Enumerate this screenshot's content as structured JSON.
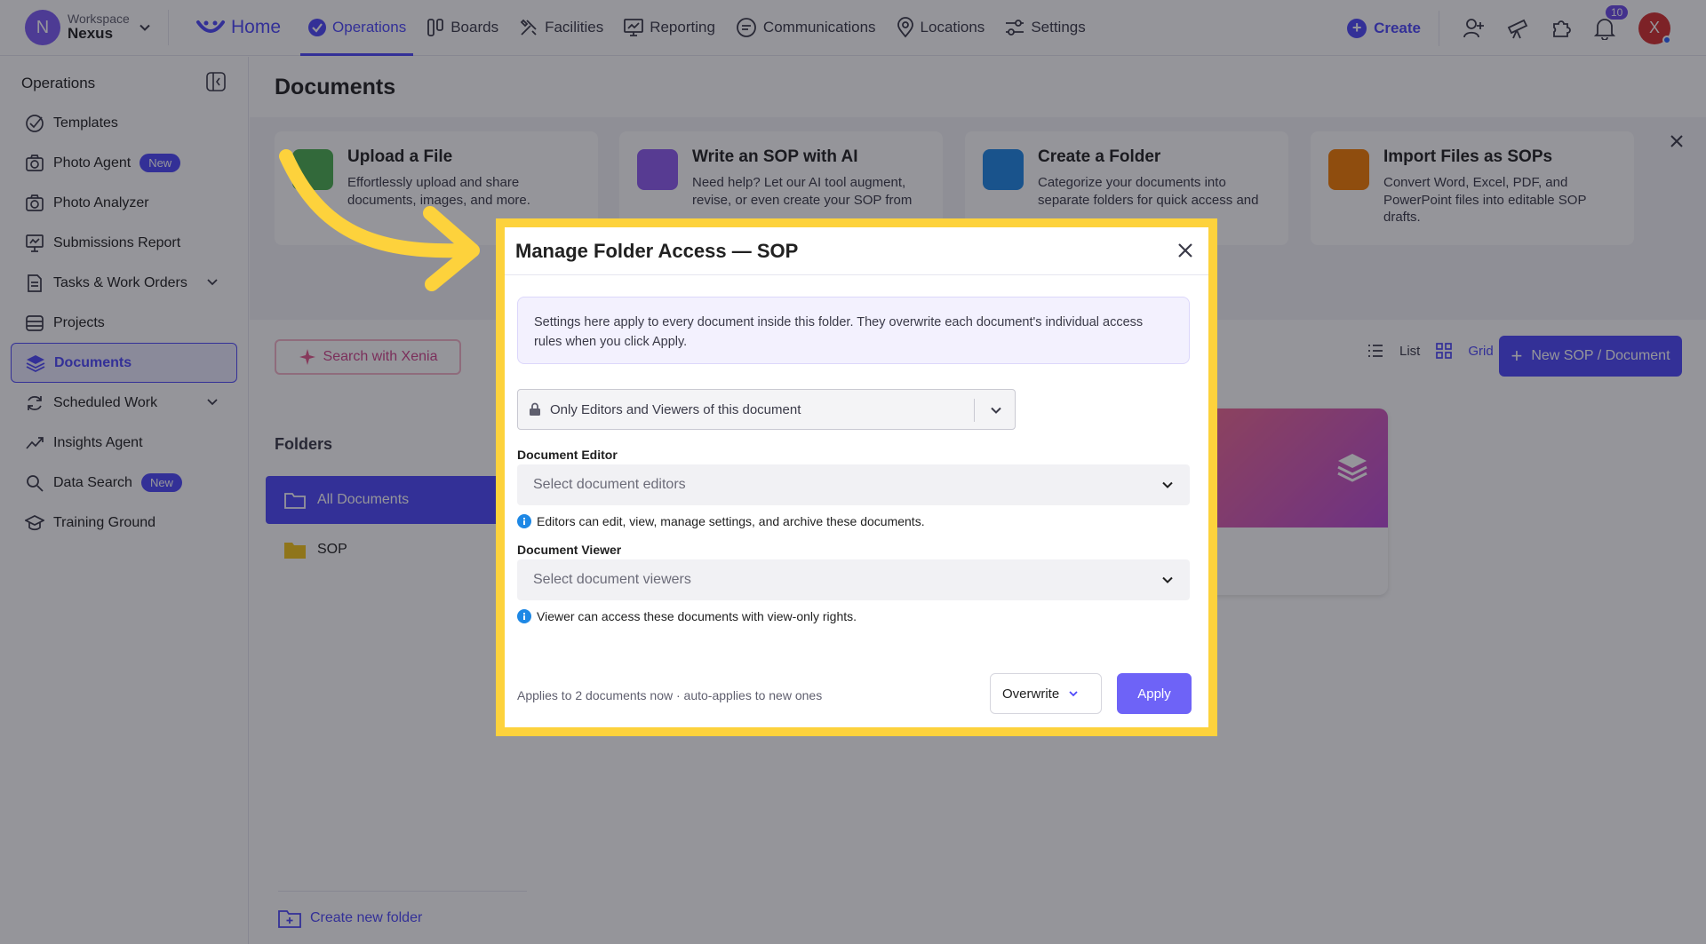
{
  "colors": {
    "accent": "#4e48fa",
    "highlight": "#fdd23c",
    "danger": "#d32f2f",
    "apply": "#6e63f7"
  },
  "topnav": {
    "workspace_label": "Workspace",
    "workspace_name": "Nexus",
    "workspace_initial": "N",
    "items": [
      {
        "label": "Home",
        "icon": "home-icon"
      },
      {
        "label": "Operations",
        "icon": "check-circle-icon"
      },
      {
        "label": "Boards",
        "icon": "boards-icon"
      },
      {
        "label": "Facilities",
        "icon": "tools-icon"
      },
      {
        "label": "Reporting",
        "icon": "chart-icon"
      },
      {
        "label": "Communications",
        "icon": "chat-icon"
      },
      {
        "label": "Locations",
        "icon": "pin-icon"
      },
      {
        "label": "Settings",
        "icon": "sliders-icon"
      }
    ],
    "create_label": "Create",
    "notification_count": "10",
    "user_initial": "X"
  },
  "sidebar": {
    "title": "Operations",
    "items": [
      {
        "label": "Templates"
      },
      {
        "label": "Photo Agent",
        "badge": "New"
      },
      {
        "label": "Photo Analyzer"
      },
      {
        "label": "Submissions Report"
      },
      {
        "label": "Tasks & Work Orders"
      },
      {
        "label": "Projects"
      },
      {
        "label": "Documents"
      },
      {
        "label": "Scheduled Work"
      },
      {
        "label": "Insights Agent"
      },
      {
        "label": "Data Search",
        "badge": "New"
      },
      {
        "label": "Training Ground"
      }
    ]
  },
  "main": {
    "title": "Documents",
    "cards": [
      {
        "title": "Upload a File",
        "desc": "Effortlessly upload and share documents, images, and more."
      },
      {
        "title": "Write an SOP with AI",
        "desc": "Need help? Let our AI tool augment, revise, or even create your SOP from"
      },
      {
        "title": "Create a Folder",
        "desc": "Categorize your documents into separate folders for quick access and"
      },
      {
        "title": "Import Files as SOPs",
        "desc": "Convert Word, Excel, PDF, and PowerPoint files into editable SOP drafts."
      }
    ],
    "search_xenia": "Search with Xenia",
    "view_list": "List",
    "view_grid": "Grid",
    "new_sop": "New SOP / Document",
    "folders_title": "Folders",
    "folders": [
      {
        "label": "All Documents"
      },
      {
        "label": "SOP"
      }
    ],
    "create_folder": "Create new folder"
  },
  "modal": {
    "title": "Manage Folder Access — SOP",
    "info": "Settings here apply to every document inside this folder. They overwrite each document's individual access rules when you click Apply.",
    "access_value": "Only Editors and Viewers of this document",
    "editor_label": "Document Editor",
    "editor_placeholder": "Select document editors",
    "editor_hint": "Editors can edit, view, manage settings, and archive these documents.",
    "viewer_label": "Document Viewer",
    "viewer_placeholder": "Select document viewers",
    "viewer_hint": "Viewer can access these documents with view-only rights.",
    "footer_note": "Applies to 2 documents now · auto-applies to new ones",
    "mode_value": "Overwrite",
    "apply_label": "Apply"
  }
}
